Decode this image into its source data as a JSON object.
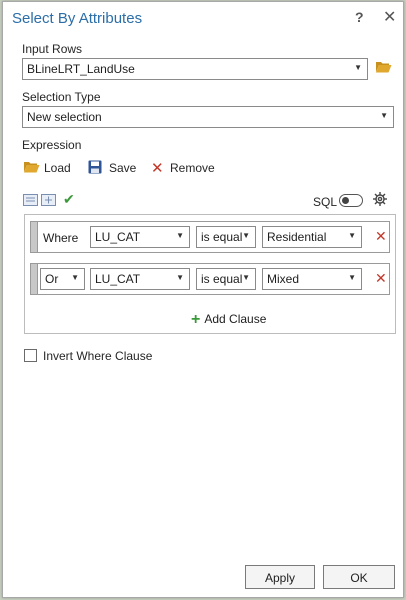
{
  "dialog": {
    "title": "Select By Attributes",
    "help_label": "?",
    "close_label": "✕"
  },
  "input_rows": {
    "label": "Input Rows",
    "value": "BLineLRT_LandUse"
  },
  "selection_type": {
    "label": "Selection Type",
    "value": "New selection"
  },
  "expression": {
    "label": "Expression",
    "load_label": "Load",
    "save_label": "Save",
    "remove_label": "Remove",
    "sql_label": "SQL",
    "sql_toggle_on": false
  },
  "clauses": [
    {
      "connector": "Where",
      "field": "LU_CAT",
      "operator": "is equal",
      "value": "Residential"
    },
    {
      "connector": "Or",
      "field": "LU_CAT",
      "operator": "is equal",
      "value": "Mixed"
    }
  ],
  "add_clause_label": "Add Clause",
  "invert_where_clause": {
    "label": "Invert Where Clause",
    "checked": false
  },
  "footer": {
    "apply_label": "Apply",
    "ok_label": "OK"
  },
  "colors": {
    "title": "#2b6ea8",
    "delete": "#c0392b",
    "add": "#3a9a3a",
    "check": "#3a9a3a",
    "folder": "#e0a82e"
  }
}
